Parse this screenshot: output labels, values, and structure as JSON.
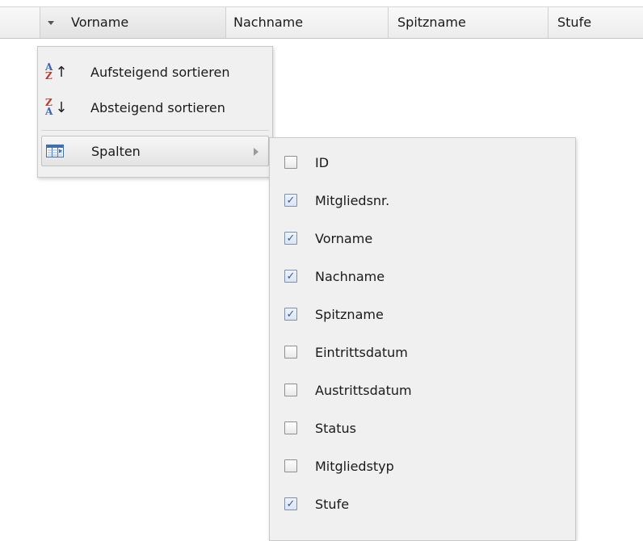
{
  "grid": {
    "columns": [
      {
        "label": "Vorname",
        "active": true
      },
      {
        "label": "Nachname",
        "active": false
      },
      {
        "label": "Spitzname",
        "active": false
      },
      {
        "label": "Stufe",
        "active": false
      }
    ]
  },
  "menu": {
    "items": [
      {
        "label": "Aufsteigend sortieren",
        "icon": "sort-ascending-icon"
      },
      {
        "label": "Absteigend sortieren",
        "icon": "sort-descending-icon"
      },
      {
        "label": "Spalten",
        "icon": "columns-icon",
        "has_submenu": true
      }
    ],
    "sort_icon_letters": {
      "asc": [
        "A",
        "Z"
      ],
      "desc": [
        "Z",
        "A"
      ]
    },
    "sort_arrows": {
      "asc": "↑",
      "desc": "↓"
    }
  },
  "columns_submenu": {
    "items": [
      {
        "label": "ID",
        "checked": false
      },
      {
        "label": "Mitgliedsnr.",
        "checked": true
      },
      {
        "label": "Vorname",
        "checked": true
      },
      {
        "label": "Nachname",
        "checked": true
      },
      {
        "label": "Spitzname",
        "checked": true
      },
      {
        "label": "Eintrittsdatum",
        "checked": false
      },
      {
        "label": "Austrittsdatum",
        "checked": false
      },
      {
        "label": "Status",
        "checked": false
      },
      {
        "label": "Mitgliedstyp",
        "checked": false
      },
      {
        "label": "Stufe",
        "checked": true
      }
    ],
    "check_glyph": "✓"
  }
}
